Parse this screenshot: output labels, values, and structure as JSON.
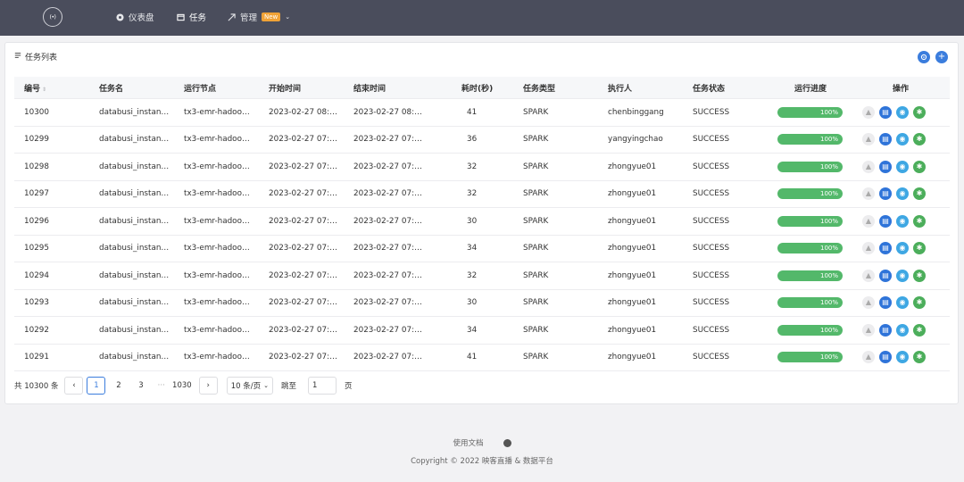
{
  "nav": {
    "logo_text": "(•)",
    "items": [
      {
        "label": "仪表盘",
        "icon": "dashboard-icon"
      },
      {
        "label": "任务",
        "icon": "calendar-icon"
      },
      {
        "label": "管理",
        "icon": "arrow-icon",
        "badge": "New"
      }
    ]
  },
  "card": {
    "title": "任务列表",
    "actions": [
      "settings-icon",
      "add-icon"
    ]
  },
  "table": {
    "headers": {
      "id": "编号",
      "name": "任务名",
      "node": "运行节点",
      "start": "开始时间",
      "end": "结束时间",
      "duration": "耗时(秒)",
      "type": "任务类型",
      "executor": "执行人",
      "status": "任务状态",
      "progress": "运行进度",
      "ops": "操作"
    },
    "rows": [
      {
        "id": "10300",
        "name": "databusi_instan…",
        "node": "tx3-emr-hadoo…",
        "start": "2023-02-27 08:…",
        "end": "2023-02-27 08:…",
        "duration": "41",
        "type": "SPARK",
        "executor": "chenbinggang",
        "status": "SUCCESS",
        "progress": "100%",
        "progress_value": 1.0
      },
      {
        "id": "10299",
        "name": "databusi_instan…",
        "node": "tx3-emr-hadoo…",
        "start": "2023-02-27 07:…",
        "end": "2023-02-27 07:…",
        "duration": "36",
        "type": "SPARK",
        "executor": "yangyingchao",
        "status": "SUCCESS",
        "progress": "100%",
        "progress_value": 1.0
      },
      {
        "id": "10298",
        "name": "databusi_instan…",
        "node": "tx3-emr-hadoo…",
        "start": "2023-02-27 07:…",
        "end": "2023-02-27 07:…",
        "duration": "32",
        "type": "SPARK",
        "executor": "zhongyue01",
        "status": "SUCCESS",
        "progress": "100%",
        "progress_value": 1.0
      },
      {
        "id": "10297",
        "name": "databusi_instan…",
        "node": "tx3-emr-hadoo…",
        "start": "2023-02-27 07:…",
        "end": "2023-02-27 07:…",
        "duration": "32",
        "type": "SPARK",
        "executor": "zhongyue01",
        "status": "SUCCESS",
        "progress": "100%",
        "progress_value": 1.0
      },
      {
        "id": "10296",
        "name": "databusi_instan…",
        "node": "tx3-emr-hadoo…",
        "start": "2023-02-27 07:…",
        "end": "2023-02-27 07:…",
        "duration": "30",
        "type": "SPARK",
        "executor": "zhongyue01",
        "status": "SUCCESS",
        "progress": "100%",
        "progress_value": 1.0
      },
      {
        "id": "10295",
        "name": "databusi_instan…",
        "node": "tx3-emr-hadoo…",
        "start": "2023-02-27 07:…",
        "end": "2023-02-27 07:…",
        "duration": "34",
        "type": "SPARK",
        "executor": "zhongyue01",
        "status": "SUCCESS",
        "progress": "100%",
        "progress_value": 1.0
      },
      {
        "id": "10294",
        "name": "databusi_instan…",
        "node": "tx3-emr-hadoo…",
        "start": "2023-02-27 07:…",
        "end": "2023-02-27 07:…",
        "duration": "32",
        "type": "SPARK",
        "executor": "zhongyue01",
        "status": "SUCCESS",
        "progress": "100%",
        "progress_value": 1.0
      },
      {
        "id": "10293",
        "name": "databusi_instan…",
        "node": "tx3-emr-hadoo…",
        "start": "2023-02-27 07:…",
        "end": "2023-02-27 07:…",
        "duration": "30",
        "type": "SPARK",
        "executor": "zhongyue01",
        "status": "SUCCESS",
        "progress": "100%",
        "progress_value": 1.0
      },
      {
        "id": "10292",
        "name": "databusi_instan…",
        "node": "tx3-emr-hadoo…",
        "start": "2023-02-27 07:…",
        "end": "2023-02-27 07:…",
        "duration": "34",
        "type": "SPARK",
        "executor": "zhongyue01",
        "status": "SUCCESS",
        "progress": "100%",
        "progress_value": 1.0
      },
      {
        "id": "10291",
        "name": "databusi_instan…",
        "node": "tx3-emr-hadoo…",
        "start": "2023-02-27 07:…",
        "end": "2023-02-27 07:…",
        "duration": "41",
        "type": "SPARK",
        "executor": "zhongyue01",
        "status": "SUCCESS",
        "progress": "100%",
        "progress_value": 1.0
      }
    ],
    "row_ops": [
      "stop-icon",
      "log-icon",
      "view-icon",
      "rerun-icon"
    ]
  },
  "pagination": {
    "total": "共 10300 条",
    "prev": "‹",
    "pages": [
      "1",
      "2",
      "3"
    ],
    "dots": "···",
    "last_page": "1030",
    "next": "›",
    "page_size": "10 条/页",
    "jump_label": "跳至",
    "jump_value": "1",
    "page_suffix": "页"
  },
  "footer": {
    "docs_link": "使用文档",
    "github_icon": "github-icon",
    "copyright": "Copyright © 2022 映客直播 & 数据平台"
  },
  "colors": {
    "nav_bg": "#4a4d5c",
    "accent": "#3b7ddd",
    "progress": "#53b86a",
    "badge": "#f0a236"
  }
}
